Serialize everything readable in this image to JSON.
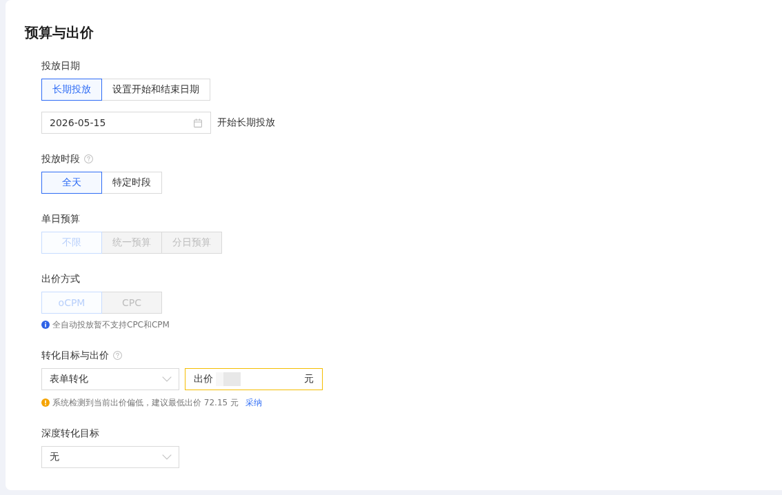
{
  "section": {
    "title": "预算与出价"
  },
  "fields": [
    {
      "label": "投放日期",
      "help": false,
      "rows": [
        {
          "kind": "segmented",
          "disabled": false,
          "options": [
            {
              "label": "长期投放",
              "selected": true
            },
            {
              "label": "设置开始和结束日期",
              "selected": false
            }
          ]
        },
        {
          "kind": "date",
          "value": "2026-05-15",
          "caption": "开始长期投放"
        }
      ]
    },
    {
      "label": "投放时段",
      "help": true,
      "rows": [
        {
          "kind": "segmented",
          "disabled": false,
          "options": [
            {
              "label": "全天",
              "selected": true
            },
            {
              "label": "特定时段",
              "selected": false
            }
          ]
        }
      ]
    },
    {
      "label": "单日预算",
      "help": false,
      "rows": [
        {
          "kind": "segmented",
          "disabled": true,
          "options": [
            {
              "label": "不限",
              "selected": true
            },
            {
              "label": "统一预算",
              "selected": false
            },
            {
              "label": "分日预算",
              "selected": false
            }
          ]
        }
      ]
    },
    {
      "label": "出价方式",
      "help": false,
      "rows": [
        {
          "kind": "segmented",
          "disabled": true,
          "options": [
            {
              "label": "oCPM",
              "selected": true
            },
            {
              "label": "CPC",
              "selected": false
            }
          ]
        },
        {
          "kind": "info_note",
          "text": "全自动投放暂不支持CPC和CPM"
        }
      ]
    },
    {
      "label": "转化目标与出价",
      "help": true,
      "rows": [
        {
          "kind": "select_price",
          "select": {
            "value": "表单转化"
          },
          "price": {
            "prefix": "出价",
            "suffix": "元",
            "warning": true,
            "value_blurred": true
          }
        },
        {
          "kind": "warning_note",
          "text": "系统检测到当前出价偏低，建议最低出价 72.15 元",
          "link": "采纳"
        }
      ]
    },
    {
      "label": "深度转化目标",
      "help": false,
      "rows": [
        {
          "kind": "select",
          "value": "无"
        }
      ]
    }
  ]
}
